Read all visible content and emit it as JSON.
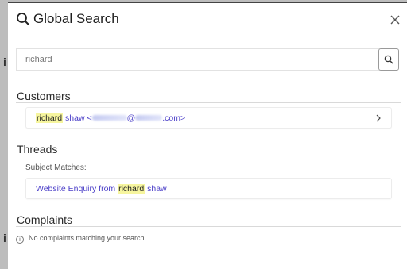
{
  "modal": {
    "title": "Global Search",
    "close_label": "×"
  },
  "search": {
    "value": "richard",
    "placeholder": ""
  },
  "sections": {
    "customers": {
      "title": "Customers",
      "result": {
        "highlight": "richard",
        "rest_name": " shaw <",
        "email_at": "@",
        "email_end": ".com>"
      }
    },
    "threads": {
      "title": "Threads",
      "sublabel": "Subject Matches:",
      "result": {
        "prefix": "Website Enquiry from ",
        "highlight": "richard",
        "suffix": " shaw"
      }
    },
    "complaints": {
      "title": "Complaints",
      "empty_text": "No complaints matching your search"
    }
  },
  "colors": {
    "link": "#4b3fc8",
    "highlight": "#f6f59e"
  }
}
